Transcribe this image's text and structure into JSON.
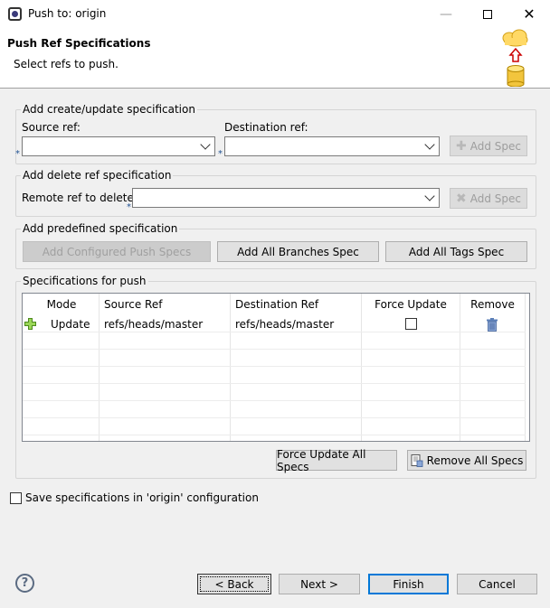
{
  "window": {
    "title": "Push to: origin"
  },
  "banner": {
    "title": "Push Ref Specifications",
    "subtitle": "Select refs to push."
  },
  "create_update": {
    "group_label": "Add create/update specification",
    "source_label": "Source ref:",
    "source_value": "",
    "destination_label": "Destination ref:",
    "destination_value": "",
    "add_spec_label": "Add Spec",
    "required_marker": "*"
  },
  "delete_ref": {
    "group_label": "Add delete ref specification",
    "remote_label": "Remote ref to delete:",
    "remote_value": "",
    "add_spec_label": "Add Spec",
    "required_marker": "*"
  },
  "predefined": {
    "group_label": "Add predefined specification",
    "configured_label": "Add Configured Push Specs",
    "all_branches_label": "Add All Branches Spec",
    "all_tags_label": "Add All Tags Spec"
  },
  "specs": {
    "group_label": "Specifications for push",
    "columns": [
      "Mode",
      "Source Ref",
      "Destination Ref",
      "Force Update",
      "Remove"
    ],
    "rows": [
      {
        "mode": "Update",
        "source": "refs/heads/master",
        "destination": "refs/heads/master",
        "force_update": false
      }
    ],
    "force_all_label": "Force Update All Specs",
    "remove_all_label": "Remove All Specs"
  },
  "save_config": {
    "label": "Save specifications in 'origin' configuration",
    "checked": false
  },
  "footer": {
    "help": "?",
    "back_label": "< Back",
    "next_label": "Next >",
    "finish_label": "Finish",
    "cancel_label": "Cancel"
  }
}
